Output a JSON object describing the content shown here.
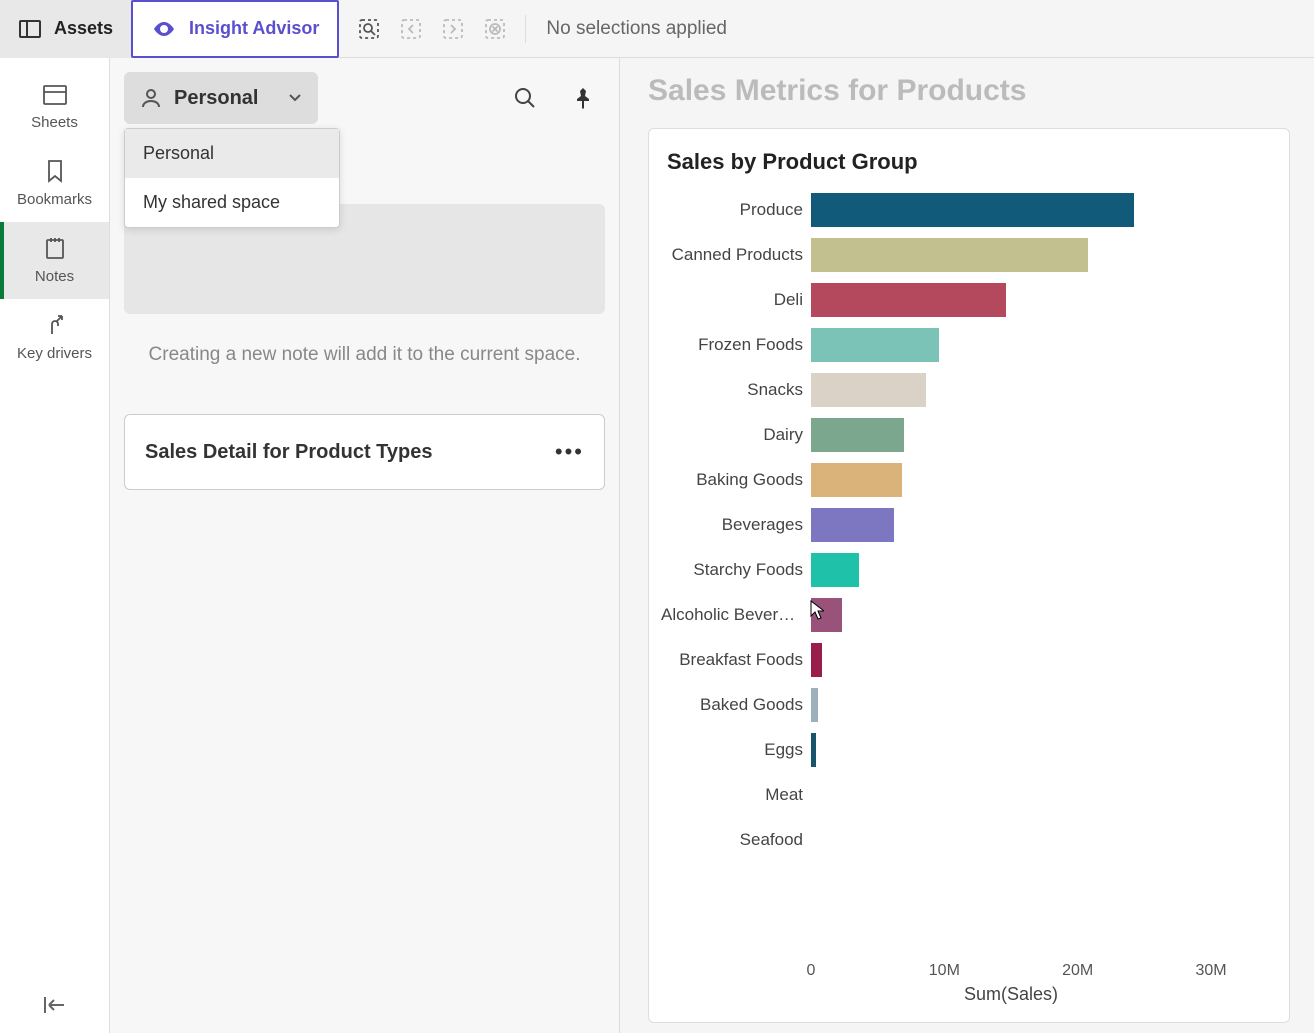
{
  "topbar": {
    "assets_label": "Assets",
    "insight_label": "Insight Advisor",
    "no_selections": "No selections applied"
  },
  "left_rail": {
    "items": [
      {
        "label": "Sheets"
      },
      {
        "label": "Bookmarks"
      },
      {
        "label": "Notes"
      },
      {
        "label": "Key drivers"
      }
    ]
  },
  "center": {
    "space_selected": "Personal",
    "dropdown_options": [
      {
        "label": "Personal",
        "selected": true
      },
      {
        "label": "My shared space",
        "selected": false
      }
    ],
    "helper": "Creating a new note will add it to the current space.",
    "note_card_title": "Sales Detail for Product Types"
  },
  "right": {
    "panel_title": "Sales Metrics for Products",
    "chart_title": "Sales by Product Group"
  },
  "chart_data": {
    "type": "bar",
    "orientation": "horizontal",
    "title": "Sales by Product Group",
    "xlabel": "Sum(Sales)",
    "ylabel": "",
    "x_ticks": [
      "0",
      "10M",
      "20M",
      "30M"
    ],
    "xlim": [
      0,
      30000000
    ],
    "categories": [
      "Produce",
      "Canned Products",
      "Deli",
      "Frozen Foods",
      "Snacks",
      "Dairy",
      "Baking Goods",
      "Beverages",
      "Starchy Foods",
      "Alcoholic Bevera…",
      "Breakfast Foods",
      "Baked Goods",
      "Eggs",
      "Meat",
      "Seafood"
    ],
    "values": [
      24200000,
      20800000,
      14600000,
      9600000,
      8600000,
      7000000,
      6800000,
      6200000,
      3600000,
      2300000,
      800000,
      500000,
      400000,
      0,
      0
    ],
    "colors": [
      "#115a79",
      "#c2c08e",
      "#b4495e",
      "#7cc3b7",
      "#dad2c6",
      "#7ba78f",
      "#d9b379",
      "#7d77c1",
      "#1fc2a8",
      "#99527a",
      "#9a1e4d",
      "#9eb0bb",
      "#18546b",
      "#999999",
      "#999999"
    ]
  }
}
